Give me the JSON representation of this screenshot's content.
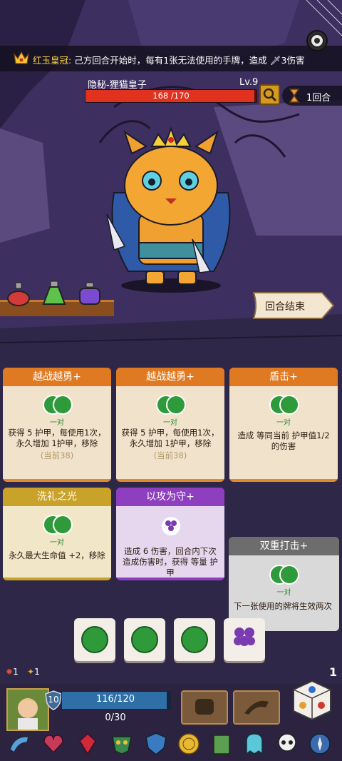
{
  "relic_banner": {
    "name": "红玉皇冠:",
    "effect": "己方回合开始时，每有1张无法使用的手牌，造成",
    "damage": "3伤害"
  },
  "enemy": {
    "name": "隐秘-狸猫皇子",
    "level": "Lv.9",
    "hp_text": "168 /170",
    "hp_current": 168,
    "hp_max": 170
  },
  "turn": {
    "label": "1回合"
  },
  "end_turn": {
    "label": "回合结束"
  },
  "potions": [
    "red-potion-icon",
    "green-potion-icon",
    "purple-potion-icon"
  ],
  "cards": [
    {
      "title": "越战越勇+",
      "req": "一对",
      "desc": "获得 5 护甲，每使用1次，永久增加 1护甲，移除",
      "note": "(当前38)",
      "color": "#e07a22"
    },
    {
      "title": "越战越勇+",
      "req": "一对",
      "desc": "获得 5 护甲，每使用1次，永久增加 1护甲，移除",
      "note": "(当前38)",
      "color": "#e07a22"
    },
    {
      "title": "盾击+",
      "req": "一对",
      "desc": "造成 等同当前 护甲值1/2的伤害",
      "note": "",
      "color": "#e07a22"
    },
    {
      "title": "洗礼之光",
      "req": "一对",
      "desc": "永久最大生命值 +2，移除",
      "note": "",
      "color": "#c9a22a"
    },
    {
      "title": "以攻为守+",
      "req": "",
      "desc": "造成 6 伤害，回合内下次造成伤害时，获得 等量 护甲",
      "note": "",
      "color": "#8e3fbf"
    },
    {
      "title": "双重打击+",
      "req": "一对",
      "desc": "下一张使用的牌将生效两次",
      "note": "",
      "color": "#6d6d6d"
    }
  ],
  "dice": [
    "melon",
    "melon",
    "melon",
    "grape"
  ],
  "status": {
    "burn": "1",
    "buff": "1",
    "deck_count": "1"
  },
  "player": {
    "shield": "10",
    "hp_text": "116/120",
    "hp_current": 116,
    "hp_max": 120,
    "energy_text": "0/30"
  },
  "relics": [
    "horn-icon",
    "heart-relic-icon",
    "ruby-icon",
    "mask-icon",
    "shield-emblem-icon",
    "gold-coin-icon",
    "spellbook-icon",
    "ghost-icon",
    "skull-icon",
    "compass-icon"
  ],
  "colors": {
    "hp_red": "#e0321f",
    "player_hp_blue": "#2e6fa7",
    "accent_gold": "#ffd54a"
  }
}
